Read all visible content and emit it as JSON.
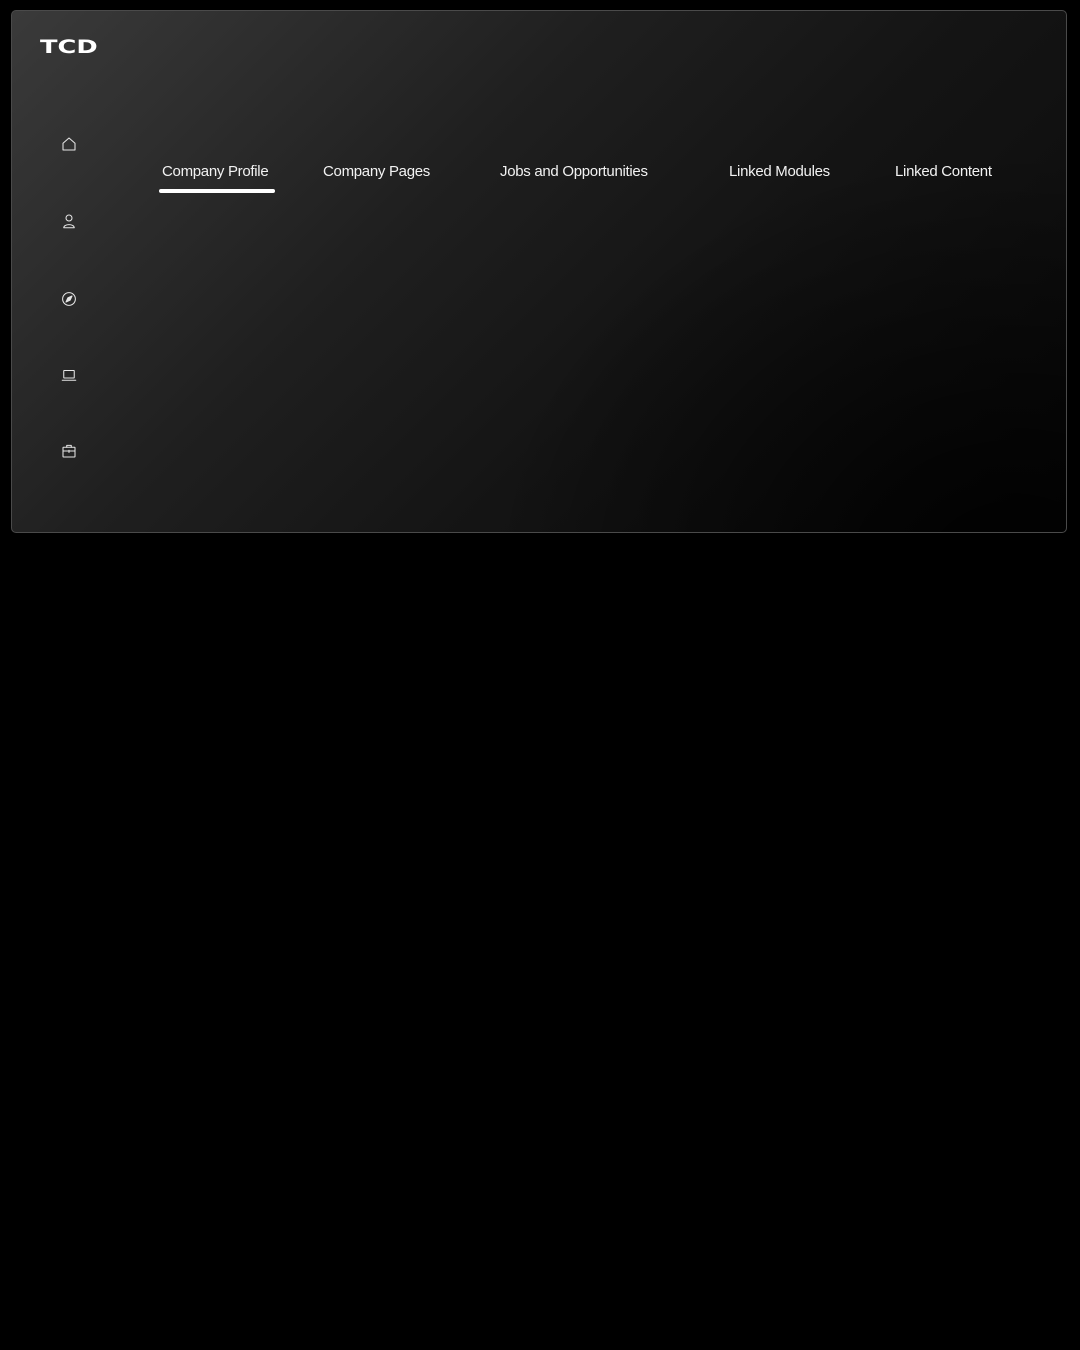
{
  "brand": {
    "logo_text": "TCD"
  },
  "sidebar": {
    "items": [
      {
        "name": "home",
        "icon": "home-icon"
      },
      {
        "name": "profile",
        "icon": "user-icon"
      },
      {
        "name": "explore",
        "icon": "compass-icon"
      },
      {
        "name": "devices",
        "icon": "laptop-icon"
      },
      {
        "name": "jobs",
        "icon": "briefcase-icon"
      }
    ]
  },
  "tabs": {
    "items": [
      {
        "label": "Company Profile",
        "active": true
      },
      {
        "label": "Company Pages",
        "active": false
      },
      {
        "label": "Jobs and Opportunities",
        "active": false
      },
      {
        "label": "Linked Modules",
        "active": false
      },
      {
        "label": "Linked Content",
        "active": false
      }
    ]
  },
  "colors": {
    "background": "#000000",
    "panel_border": "#4a4a4a",
    "text": "#f2f2f2",
    "active_indicator": "#ffffff"
  }
}
